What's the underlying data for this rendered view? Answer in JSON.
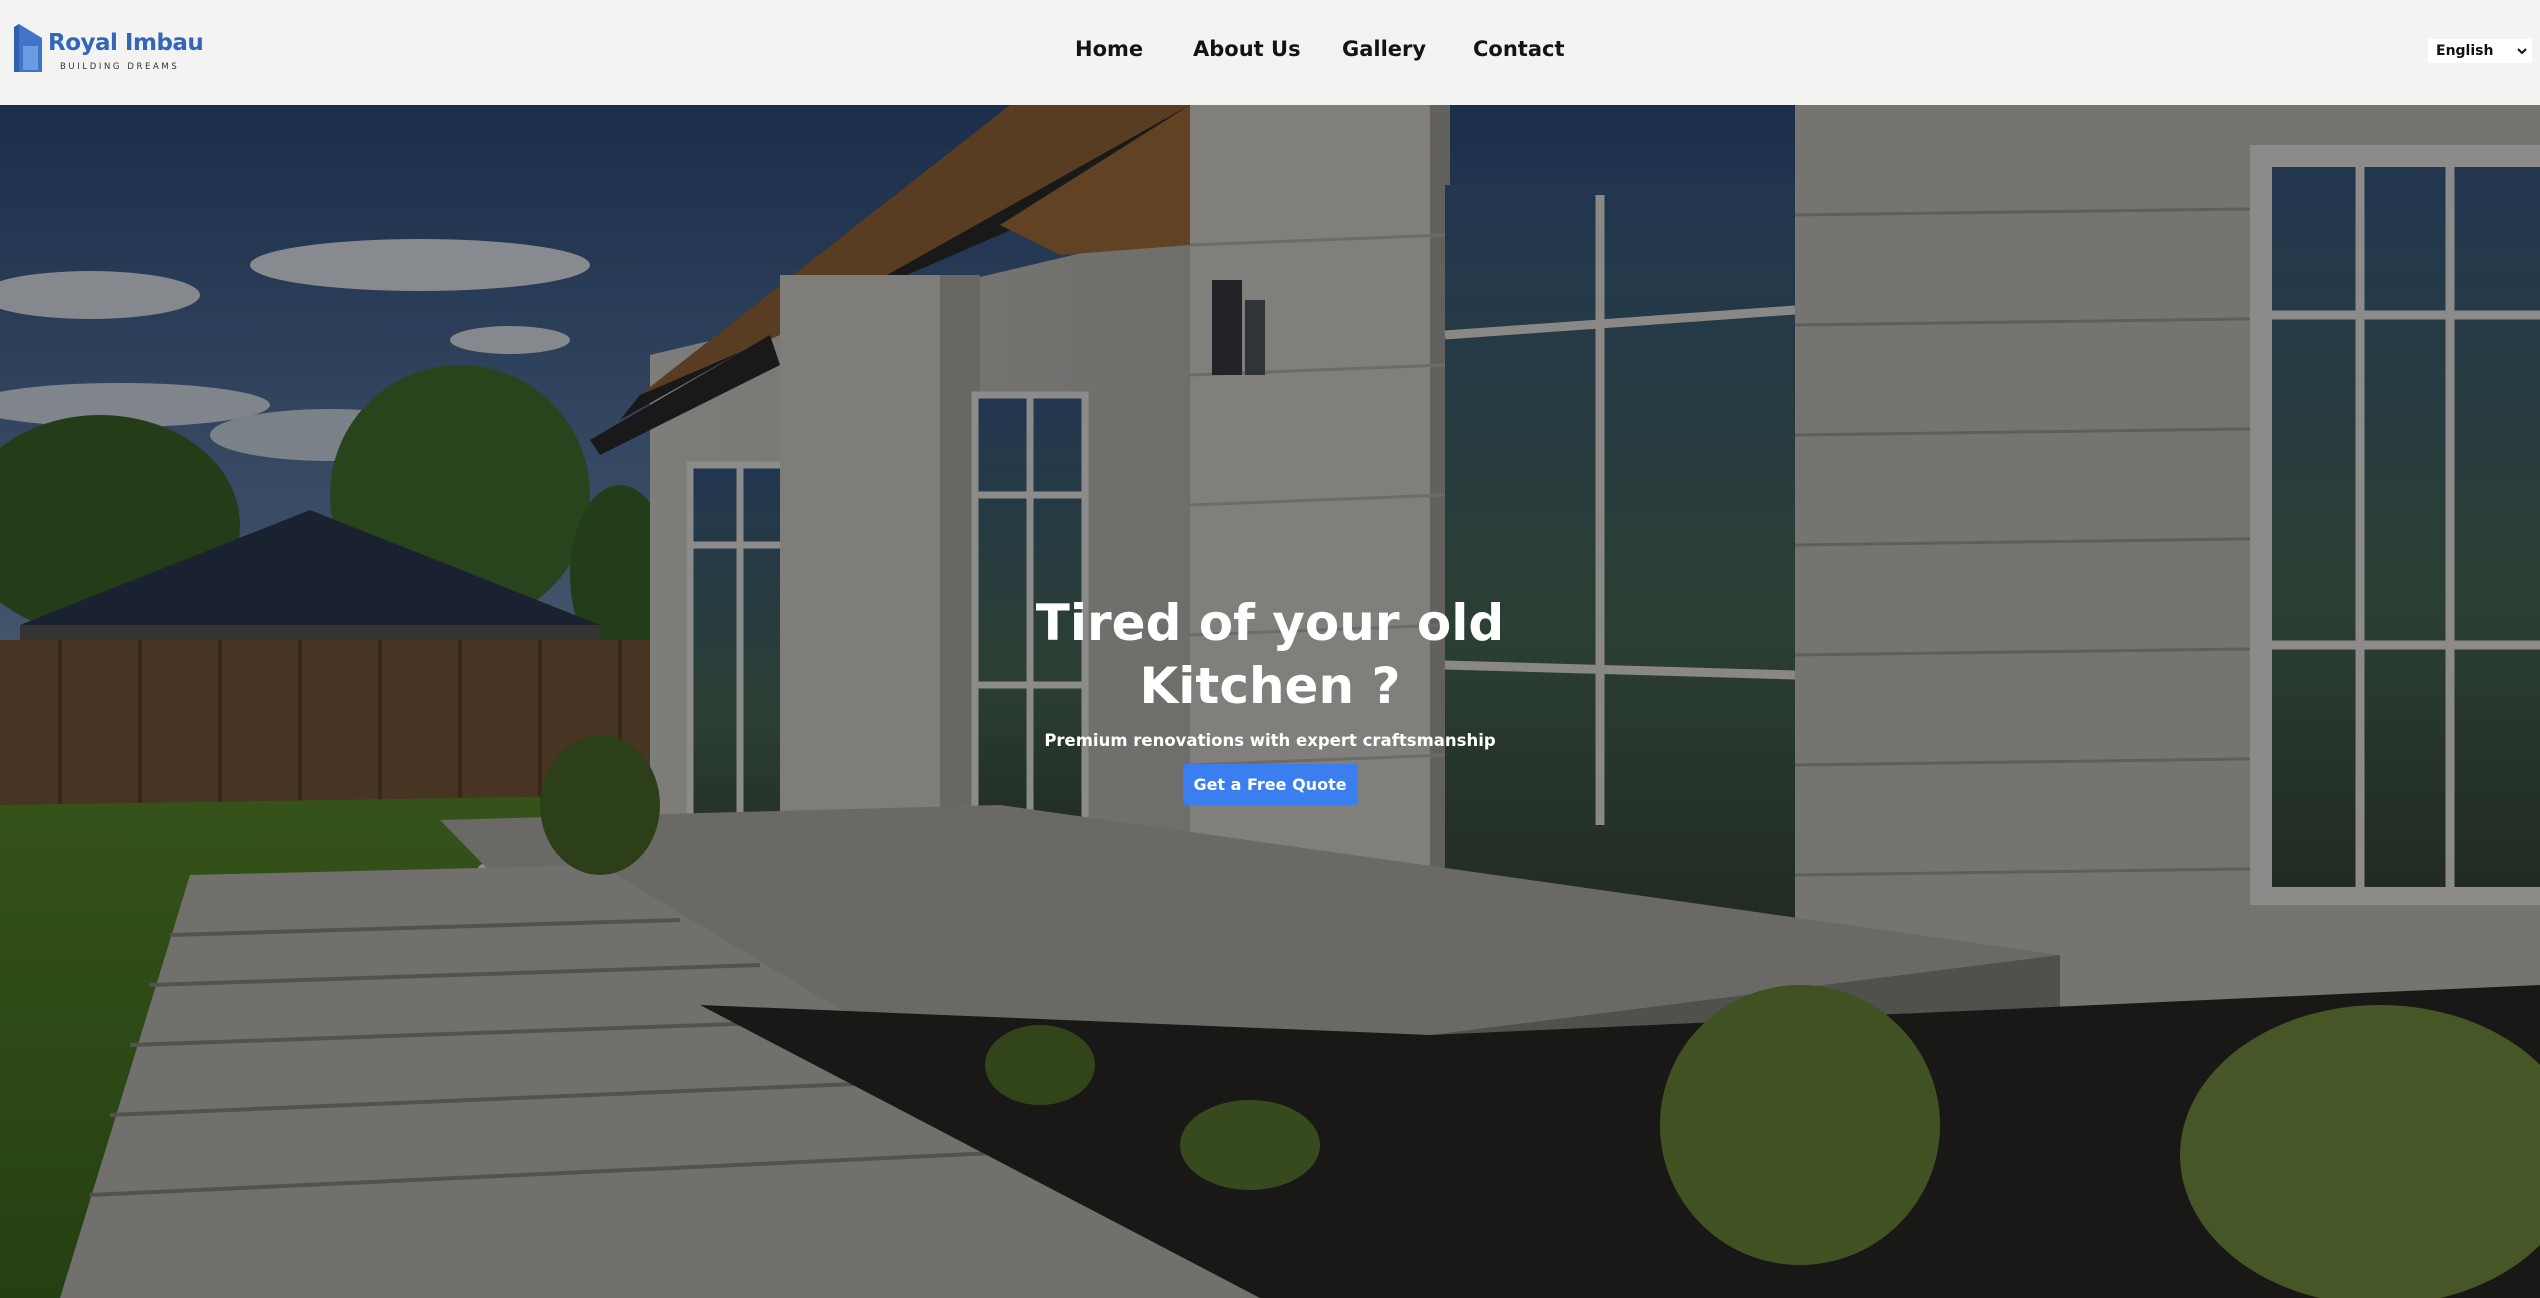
{
  "brand": {
    "name": "Royal Imbau",
    "tagline": "BUILDING DREAMS",
    "logo_icon": "building-logo-icon",
    "color": "#3466b8"
  },
  "nav": {
    "items": [
      {
        "label": "Home"
      },
      {
        "label": "About Us"
      },
      {
        "label": "Gallery"
      },
      {
        "label": "Contact"
      }
    ]
  },
  "language": {
    "selected": "English",
    "icon": "chevron-down-icon"
  },
  "hero": {
    "title_line1": "Tired of your old",
    "title_line2": "Kitchen ?",
    "subtitle": "Premium renovations with expert craftsmanship",
    "cta_label": "Get a Free Quote",
    "cta_color": "#3b7ef0"
  }
}
